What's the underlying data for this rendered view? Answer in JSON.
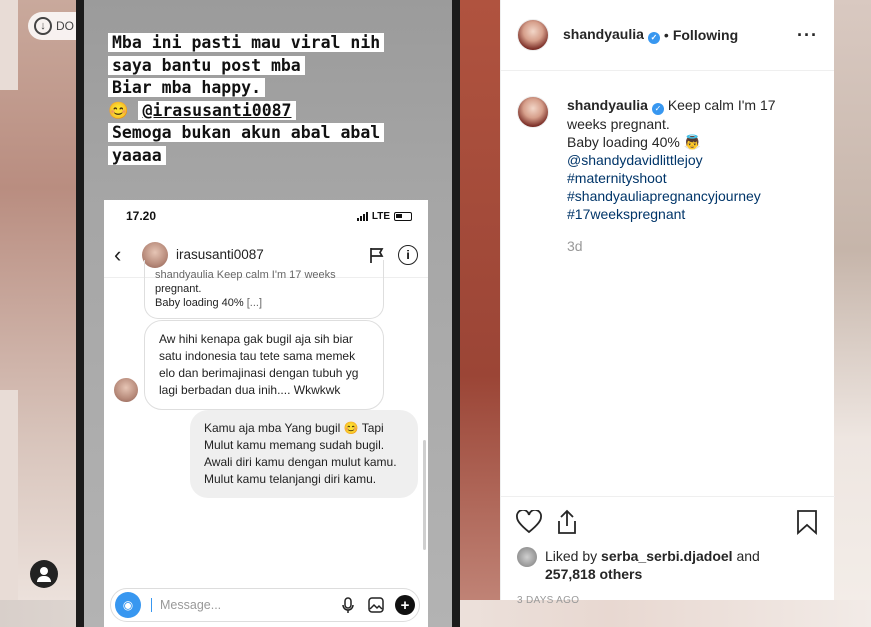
{
  "download_badge": {
    "label": "DO"
  },
  "story": {
    "lines": [
      "Mba ini pasti mau viral nih",
      "saya bantu post mba",
      "Biar mba happy.",
      "@irasusanti0087",
      "Semoga bukan akun abal abal",
      "yaaaa"
    ],
    "emoji": "😊"
  },
  "phone": {
    "time": "17.20",
    "network": "LTE",
    "dm_username": "irasusanti0087",
    "messages": [
      {
        "line1": "shandyaulia Keep calm I'm 17 weeks",
        "line2": "pregnant.",
        "line3": "Baby loading 40%",
        "more": "[...]"
      },
      {
        "text": "Aw hihi kenapa gak bugil aja sih biar satu indonesia tau tete sama memek elo dan berimajinasi dengan tubuh yg lagi berbadan dua inih....  Wkwkwk"
      },
      {
        "text": "Kamu aja mba Yang bugil 😊 Tapi Mulut kamu memang sudah bugil. Awali diri kamu dengan mulut kamu. Mulut kamu telanjangi diri kamu."
      }
    ],
    "composer_placeholder": "Message..."
  },
  "panel": {
    "username": "shandyaulia",
    "following": "Following",
    "caption_text": "Keep calm I'm 17 weeks pregnant.",
    "caption_line2": "Baby loading 40% 👼",
    "hashtags": [
      "@shandydavidlittlejoy",
      "#maternityshoot",
      "#shandyauliapregnancyjourney",
      "#17weekspregnant"
    ],
    "caption_age": "3d",
    "liked_by_prefix": "Liked by",
    "liked_by_user": "serba_serbi.djadoel",
    "liked_by_and": "and",
    "others_count": "257,818 others",
    "post_date": "3 DAYS AGO"
  }
}
